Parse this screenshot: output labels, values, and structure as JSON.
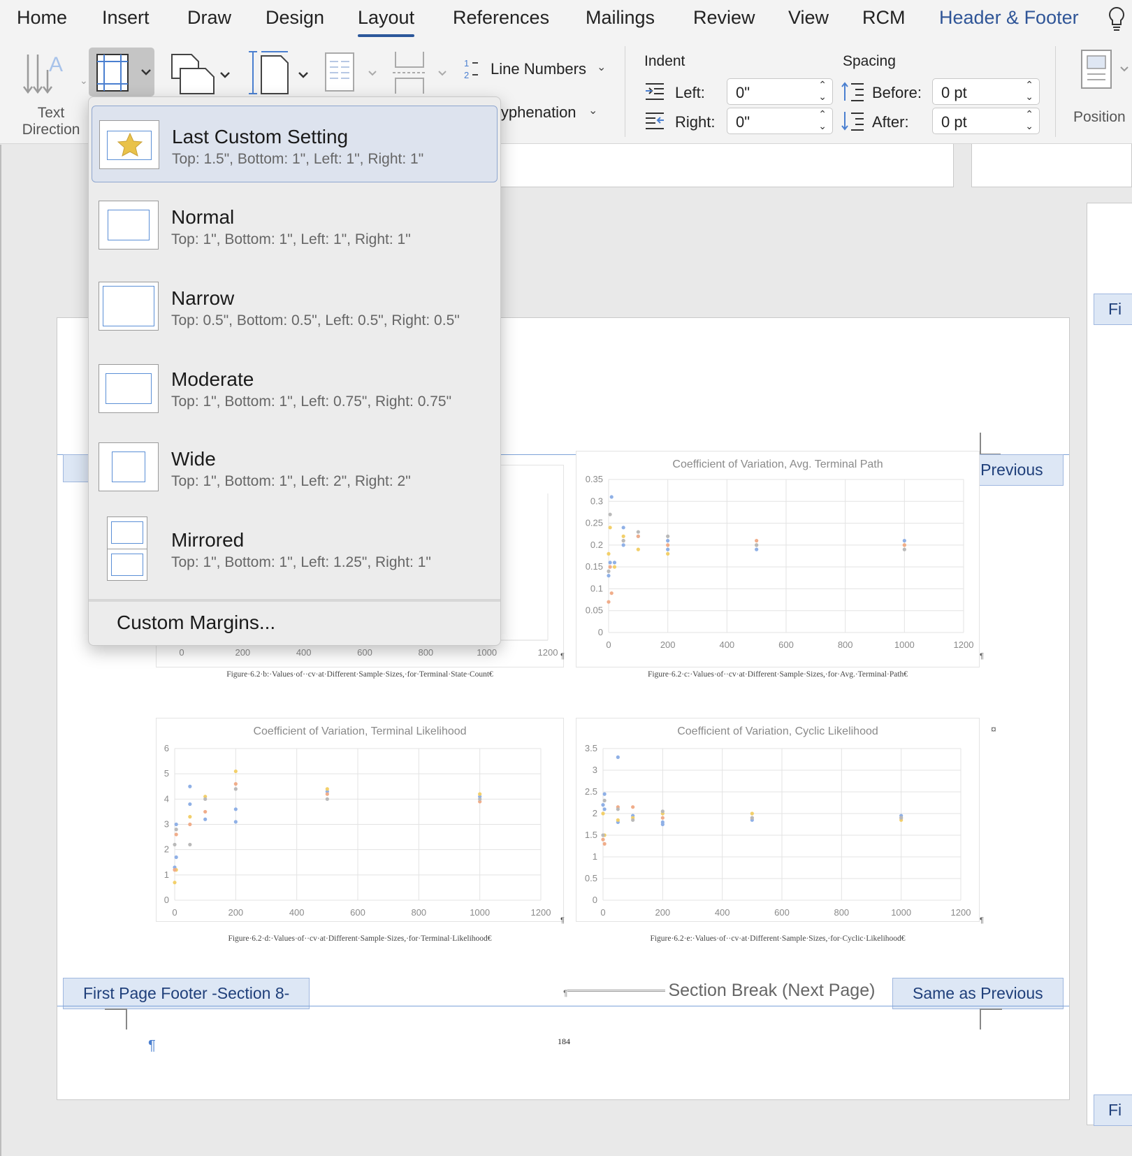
{
  "tabs": [
    "Home",
    "Insert",
    "Draw",
    "Design",
    "Layout",
    "References",
    "Mailings",
    "Review",
    "View",
    "RCM",
    "Header & Footer"
  ],
  "ribbon": {
    "text_direction": "Text Direction",
    "line_numbers": "Line Numbers",
    "hyphenation": "Hyphenation",
    "hyphenation_visible": "lyphenation",
    "indent_label": "Indent",
    "indent_left_label": "Left:",
    "indent_left_value": "0\"",
    "indent_right_label": "Right:",
    "indent_right_value": "0\"",
    "spacing_label": "Spacing",
    "before_label": "Before:",
    "before_value": "0 pt",
    "after_label": "After:",
    "after_value": "0 pt",
    "position": "Position"
  },
  "margins_menu": {
    "options": [
      {
        "name": "Last Custom Setting",
        "desc": "Top: 1.5\", Bottom: 1\", Left: 1\", Right: 1\"",
        "icon": "star-icon",
        "selected": true
      },
      {
        "name": "Normal",
        "desc": "Top: 1\", Bottom: 1\", Left: 1\", Right: 1\"",
        "icon": "margins-normal-icon"
      },
      {
        "name": "Narrow",
        "desc": "Top: 0.5\", Bottom: 0.5\", Left: 0.5\", Right: 0.5\"",
        "icon": "margins-narrow-icon"
      },
      {
        "name": "Moderate",
        "desc": "Top: 1\", Bottom: 1\", Left: 0.75\", Right: 0.75\"",
        "icon": "margins-moderate-icon"
      },
      {
        "name": "Wide",
        "desc": "Top: 1\", Bottom: 1\", Left: 2\", Right: 2\"",
        "icon": "margins-wide-icon"
      },
      {
        "name": "Mirrored",
        "desc": "Top: 1\", Bottom: 1\", Left: 1.25\", Right: 1\"",
        "icon": "margins-mirrored-icon"
      }
    ],
    "custom": "Custom Margins..."
  },
  "document": {
    "same_as_previous": "Same as Previous",
    "first_page_footer": "First Page Footer -Section 8-",
    "section_break": "Section Break (Next Page)",
    "page_number": "184",
    "pilcrow": "¶",
    "side_tag": "Fi"
  },
  "chart_data": [
    {
      "type": "scatter",
      "title": "",
      "caption": "Figure·6.2·b:·Values·of··cv·at·Different·Sample·Sizes,·for·Terminal·State·Count€",
      "x_ticks": [
        "0",
        "200",
        "400",
        "600",
        "800",
        "1000",
        "1200"
      ],
      "xlim": [
        0,
        1200
      ],
      "partially_hidden": true
    },
    {
      "type": "scatter",
      "title": "Coefficient of Variation, Avg. Terminal Path",
      "caption": "Figure·6.2·c:·Values·of··cv·at·Different·Sample·Sizes,·for·Avg.·Terminal·Path€",
      "x_ticks": [
        "0",
        "200",
        "400",
        "600",
        "800",
        "1000",
        "1200"
      ],
      "y_ticks": [
        "0",
        "0.05",
        "0.1",
        "0.15",
        "0.2",
        "0.25",
        "0.3",
        "0.35"
      ],
      "xlim": [
        0,
        1200
      ],
      "ylim": [
        0,
        0.35
      ],
      "series": [
        {
          "color": "#8fb0e6",
          "points": [
            [
              0,
              0.13
            ],
            [
              5,
              0.16
            ],
            [
              10,
              0.31
            ],
            [
              20,
              0.16
            ],
            [
              50,
              0.24
            ],
            [
              50,
              0.2
            ],
            [
              100,
              0.22
            ],
            [
              200,
              0.21
            ],
            [
              200,
              0.19
            ],
            [
              500,
              0.19
            ],
            [
              1000,
              0.21
            ]
          ]
        },
        {
          "color": "#f2cf6a",
          "points": [
            [
              0,
              0.18
            ],
            [
              5,
              0.24
            ],
            [
              20,
              0.15
            ],
            [
              50,
              0.22
            ],
            [
              100,
              0.19
            ],
            [
              200,
              0.18
            ],
            [
              500,
              0.2
            ],
            [
              1000,
              0.2
            ]
          ]
        },
        {
          "color": "#f0ad8a",
          "points": [
            [
              0,
              0.07
            ],
            [
              5,
              0.15
            ],
            [
              10,
              0.09
            ],
            [
              50,
              0.21
            ],
            [
              100,
              0.22
            ],
            [
              200,
              0.2
            ],
            [
              500,
              0.21
            ],
            [
              1000,
              0.2
            ]
          ]
        },
        {
          "color": "#b9b9b9",
          "points": [
            [
              0,
              0.14
            ],
            [
              5,
              0.27
            ],
            [
              50,
              0.21
            ],
            [
              100,
              0.23
            ],
            [
              200,
              0.22
            ],
            [
              500,
              0.2
            ],
            [
              1000,
              0.19
            ]
          ]
        }
      ]
    },
    {
      "type": "scatter",
      "title": "Coefficient of Variation, Terminal Likelihood",
      "caption": "Figure·6.2·d:·Values·of··cv·at·Different·Sample·Sizes,·for·Terminal·Likelihood€",
      "x_ticks": [
        "0",
        "200",
        "400",
        "600",
        "800",
        "1000",
        "1200"
      ],
      "y_ticks": [
        "0",
        "1",
        "2",
        "3",
        "4",
        "5",
        "6"
      ],
      "xlim": [
        0,
        1200
      ],
      "ylim": [
        0,
        6
      ],
      "series": [
        {
          "color": "#8fb0e6",
          "points": [
            [
              0,
              1.3
            ],
            [
              5,
              1.7
            ],
            [
              5,
              3.0
            ],
            [
              50,
              4.5
            ],
            [
              50,
              3.8
            ],
            [
              100,
              3.2
            ],
            [
              200,
              3.6
            ],
            [
              200,
              3.1
            ],
            [
              500,
              4.3
            ],
            [
              1000,
              4.1
            ]
          ]
        },
        {
          "color": "#f2cf6a",
          "points": [
            [
              0,
              0.7
            ],
            [
              5,
              1.2
            ],
            [
              50,
              3.3
            ],
            [
              100,
              4.1
            ],
            [
              200,
              5.1
            ],
            [
              500,
              4.4
            ],
            [
              1000,
              4.2
            ]
          ]
        },
        {
          "color": "#f0ad8a",
          "points": [
            [
              0,
              1.2
            ],
            [
              5,
              2.6
            ],
            [
              50,
              3.0
            ],
            [
              100,
              3.5
            ],
            [
              200,
              4.6
            ],
            [
              500,
              4.2
            ],
            [
              1000,
              3.9
            ]
          ]
        },
        {
          "color": "#b9b9b9",
          "points": [
            [
              0,
              2.2
            ],
            [
              5,
              2.8
            ],
            [
              50,
              2.2
            ],
            [
              100,
              4.0
            ],
            [
              200,
              4.4
            ],
            [
              500,
              4.0
            ],
            [
              1000,
              4.0
            ]
          ]
        }
      ]
    },
    {
      "type": "scatter",
      "title": "Coefficient of Variation, Cyclic Likelihood",
      "caption": "Figure·6.2·e:·Values·of··cv·at·Different·Sample·Sizes,·for·Cyclic·Likelihood€",
      "x_ticks": [
        "0",
        "200",
        "400",
        "600",
        "800",
        "1000",
        "1200"
      ],
      "y_ticks": [
        "0",
        "0.5",
        "1",
        "1.5",
        "2",
        "2.5",
        "3",
        "3.5"
      ],
      "xlim": [
        0,
        1200
      ],
      "ylim": [
        0,
        3.5
      ],
      "series": [
        {
          "color": "#8fb0e6",
          "points": [
            [
              0,
              2.2
            ],
            [
              5,
              2.45
            ],
            [
              5,
              2.1
            ],
            [
              50,
              3.3
            ],
            [
              50,
              1.8
            ],
            [
              100,
              1.95
            ],
            [
              200,
              1.8
            ],
            [
              200,
              1.75
            ],
            [
              500,
              1.85
            ],
            [
              1000,
              1.95
            ]
          ]
        },
        {
          "color": "#f2cf6a",
          "points": [
            [
              0,
              2.0
            ],
            [
              5,
              1.5
            ],
            [
              50,
              1.85
            ],
            [
              100,
              1.9
            ],
            [
              200,
              2.0
            ],
            [
              500,
              2.0
            ],
            [
              1000,
              1.85
            ]
          ]
        },
        {
          "color": "#f0ad8a",
          "points": [
            [
              0,
              1.4
            ],
            [
              5,
              1.3
            ],
            [
              50,
              2.15
            ],
            [
              100,
              2.15
            ],
            [
              200,
              1.9
            ],
            [
              500,
              1.9
            ],
            [
              1000,
              1.9
            ]
          ]
        },
        {
          "color": "#b9b9b9",
          "points": [
            [
              0,
              1.5
            ],
            [
              5,
              2.3
            ],
            [
              50,
              2.1
            ],
            [
              100,
              1.85
            ],
            [
              200,
              2.05
            ],
            [
              500,
              1.9
            ],
            [
              1000,
              1.9
            ]
          ]
        }
      ]
    }
  ]
}
